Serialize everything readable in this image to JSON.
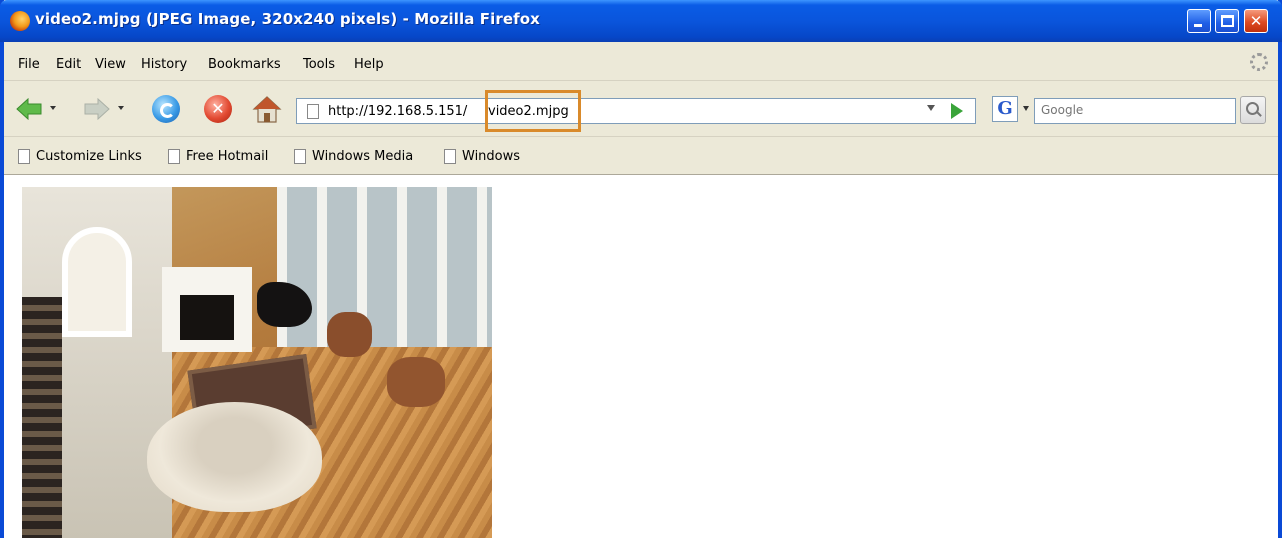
{
  "window": {
    "title": "video2.mjpg (JPEG Image, 320x240 pixels) - Mozilla Firefox",
    "icon": "firefox-logo-icon"
  },
  "titlebar_buttons": {
    "minimize": "minimize-icon",
    "maximize": "maximize-icon",
    "close": "✕"
  },
  "menu": {
    "items": [
      "File",
      "Edit",
      "View",
      "History",
      "Bookmarks",
      "Tools",
      "Help"
    ]
  },
  "nav": {
    "back": "back-arrow-icon",
    "forward": "forward-arrow-icon",
    "reload": "reload-icon",
    "stop": "✕",
    "home": "home-icon"
  },
  "urlbar": {
    "host": "http://192.168.5.151/",
    "path": "video2.mjpg",
    "highlight_color": "#d98a2b"
  },
  "search": {
    "engine_glyph": "G",
    "placeholder": "Google"
  },
  "bookmarks": {
    "items": [
      "Customize Links",
      "Free Hotmail",
      "Windows Media",
      "Windows"
    ]
  },
  "content": {
    "image_alt": "living-room-camera-frame"
  },
  "colors": {
    "titlebar": "#0a55dc",
    "chrome": "#ece9d8",
    "close_button": "#de4b22"
  }
}
